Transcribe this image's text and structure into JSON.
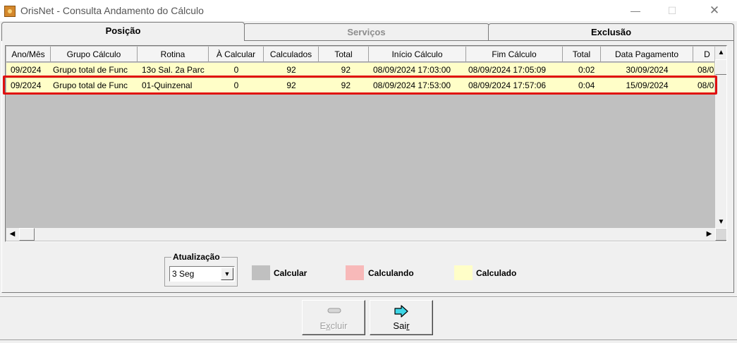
{
  "window": {
    "title": "OrisNet - Consulta Andamento do Cálculo",
    "icon": "app-icon",
    "minimize_glyph": "—",
    "maximize_glyph": "☐",
    "close_glyph": "✕"
  },
  "tabs": [
    {
      "label": "Posição",
      "active": true
    },
    {
      "label": "Serviços",
      "active": false,
      "disabled": true
    },
    {
      "label": "Exclusão",
      "active": false
    }
  ],
  "grid": {
    "columns": [
      "Ano/Mês",
      "Grupo Cálculo",
      "Rotina",
      "À Calcular",
      "Calculados",
      "Total",
      "Início Cálculo",
      "Fim Cálculo",
      "Total",
      "Data Pagamento",
      "D"
    ],
    "rows": [
      [
        "09/2024",
        "Grupo total de Func",
        "13o Sal. 2a Parc",
        "0",
        "92",
        "92",
        "08/09/2024 17:03:00",
        "08/09/2024 17:05:09",
        "0:02",
        "30/09/2024",
        "08/0"
      ],
      [
        "09/2024",
        "Grupo total de Func",
        "01-Quinzenal",
        "0",
        "92",
        "92",
        "08/09/2024 17:53:00",
        "08/09/2024 17:57:06",
        "0:04",
        "15/09/2024",
        "08/0"
      ]
    ],
    "selected_row": 1,
    "highlight_color": "#e11010",
    "row_color": "#fffec8",
    "empty_color": "#c0c0c0"
  },
  "scroll": {
    "up_glyph": "▲",
    "down_glyph": "▼",
    "left_glyph": "◀",
    "right_glyph": "▶"
  },
  "atualizacao": {
    "label": "Atualização",
    "selected": "3 Seg",
    "dropdown_glyph": "▼"
  },
  "legend": [
    {
      "label": "Calcular",
      "color": "#c0c0c0"
    },
    {
      "label": "Calculando",
      "color": "#f8b9b9"
    },
    {
      "label": "Calculado",
      "color": "#fffec8"
    }
  ],
  "buttons": {
    "excluir": {
      "label": "Excluir",
      "icon": "minus-bar-icon",
      "enabled": false
    },
    "sair": {
      "label": "Sair",
      "icon": "right-arrow-icon",
      "enabled": true
    }
  }
}
